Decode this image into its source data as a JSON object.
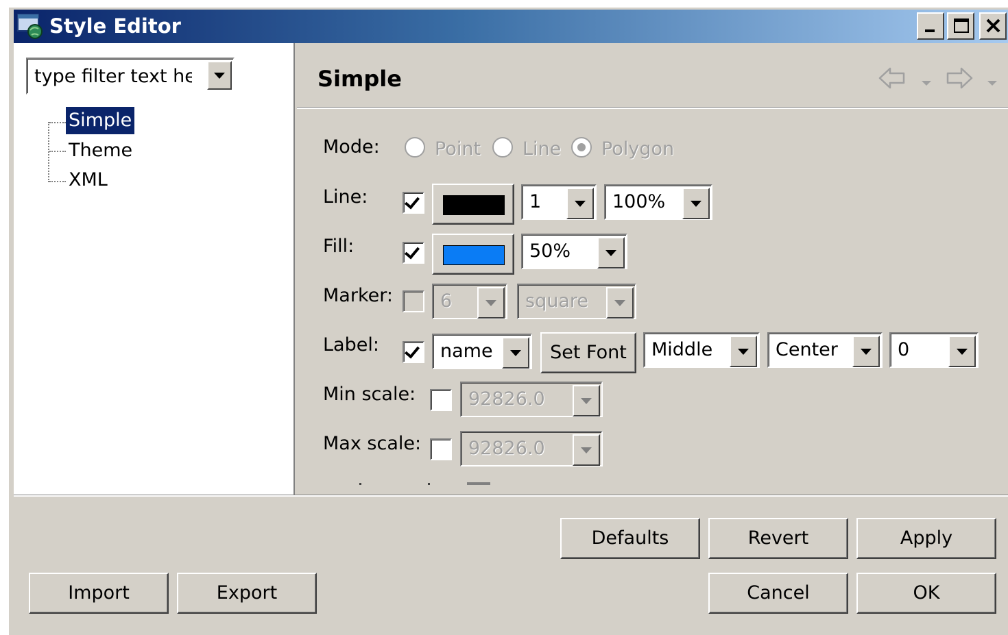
{
  "window": {
    "title": "Style Editor",
    "colors": {
      "title_start": "#0a246a",
      "title_end": "#a6caf0",
      "face": "#d4d0c8"
    }
  },
  "sidebar": {
    "filter_value": "type filter text her",
    "items": [
      {
        "label": "Simple",
        "selected": true
      },
      {
        "label": "Theme",
        "selected": false
      },
      {
        "label": "XML",
        "selected": false
      }
    ]
  },
  "page": {
    "title": "Simple"
  },
  "form": {
    "mode": {
      "label": "Mode:",
      "options": [
        {
          "label": "Point",
          "selected": false
        },
        {
          "label": "Line",
          "selected": false
        },
        {
          "label": "Polygon",
          "selected": true
        }
      ],
      "enabled": false
    },
    "line": {
      "label": "Line:",
      "checked": true,
      "color": "#000000",
      "width": "1",
      "opacity": "100%"
    },
    "fill": {
      "label": "Fill:",
      "checked": true,
      "color": "#0a7cf5",
      "opacity": "50%"
    },
    "marker": {
      "label": "Marker:",
      "checked": false,
      "size": "6",
      "shape": "square",
      "enabled": false
    },
    "label": {
      "label": "Label:",
      "checked": true,
      "attribute": "name",
      "set_font": "Set Font",
      "vertical": "Middle",
      "horizontal": "Center",
      "rotation": "0"
    },
    "min_scale": {
      "label": "Min scale:",
      "checked": false,
      "value": "92826.0"
    },
    "max_scale": {
      "label": "Max scale:",
      "checked": false,
      "value": "92826.0"
    }
  },
  "buttons": {
    "defaults": "Defaults",
    "revert": "Revert",
    "apply": "Apply",
    "import": "Import",
    "export": "Export",
    "cancel": "Cancel",
    "ok": "OK"
  },
  "icons": [
    "app-icon",
    "minimize-icon",
    "maximize-icon",
    "close-icon",
    "back-arrow-icon",
    "forward-arrow-icon",
    "chevron-down-icon"
  ]
}
